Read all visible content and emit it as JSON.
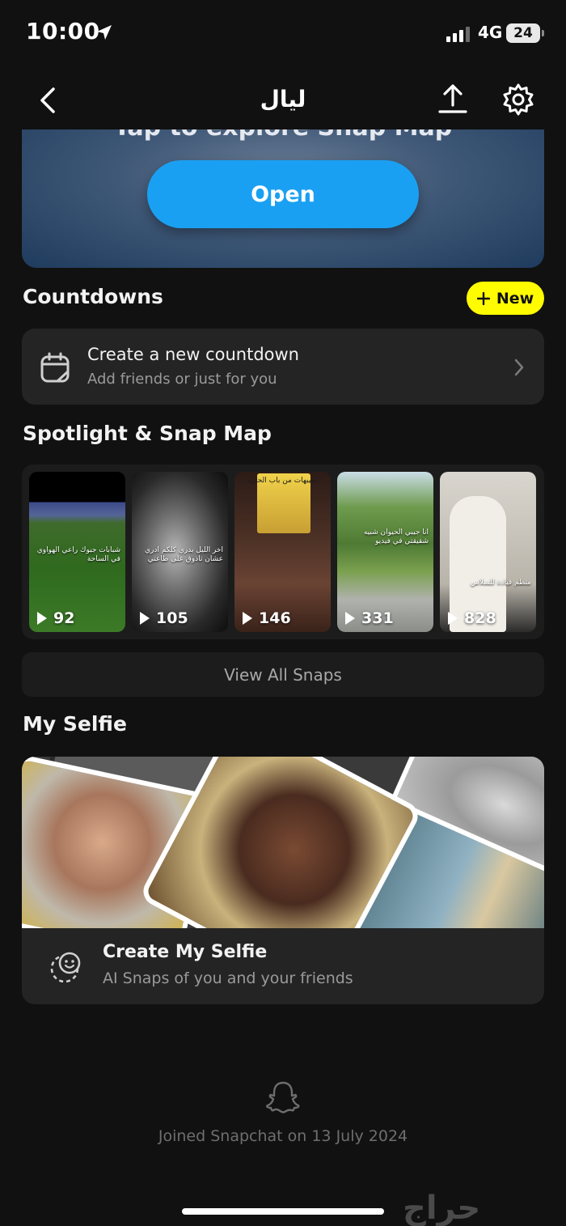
{
  "status_bar": {
    "time": "10:00",
    "network": "4G",
    "battery": "24"
  },
  "header": {
    "title": "ليال"
  },
  "map_banner": {
    "text": "Tap to explore Snap Map",
    "button_label": "Open"
  },
  "countdowns": {
    "heading": "Countdowns",
    "new_label": "New",
    "card_title": "Create a new countdown",
    "card_subtitle": "Add friends or just for you"
  },
  "spotlight": {
    "heading": "Spotlight & Snap Map",
    "tiles": [
      {
        "views": "92",
        "caption": "شبابات جبوك راعي الهواوي في الساحة"
      },
      {
        "views": "105",
        "caption": "اخر الليل بدري كلكم ادري عشان تاذوق على طاعتي"
      },
      {
        "views": "146",
        "caption": "شيبهات من باب الحارة"
      },
      {
        "views": "331",
        "caption": "انا جيبي الحيوان شبيه شقيقتي في فيديو"
      },
      {
        "views": "828",
        "caption": "منظم قيادة للسلاس"
      }
    ],
    "view_all_label": "View All Snaps"
  },
  "selfie": {
    "heading": "My Selfie",
    "card_title": "Create My Selfie",
    "card_subtitle": "AI Snaps of you and your friends"
  },
  "footer": {
    "joined_text": "Joined Snapchat on 13 July 2024",
    "watermark": "حراج"
  },
  "colors": {
    "accent_yellow": "#fffc00",
    "open_button": "#1aa0f2",
    "background": "#111111",
    "card": "#242424"
  }
}
